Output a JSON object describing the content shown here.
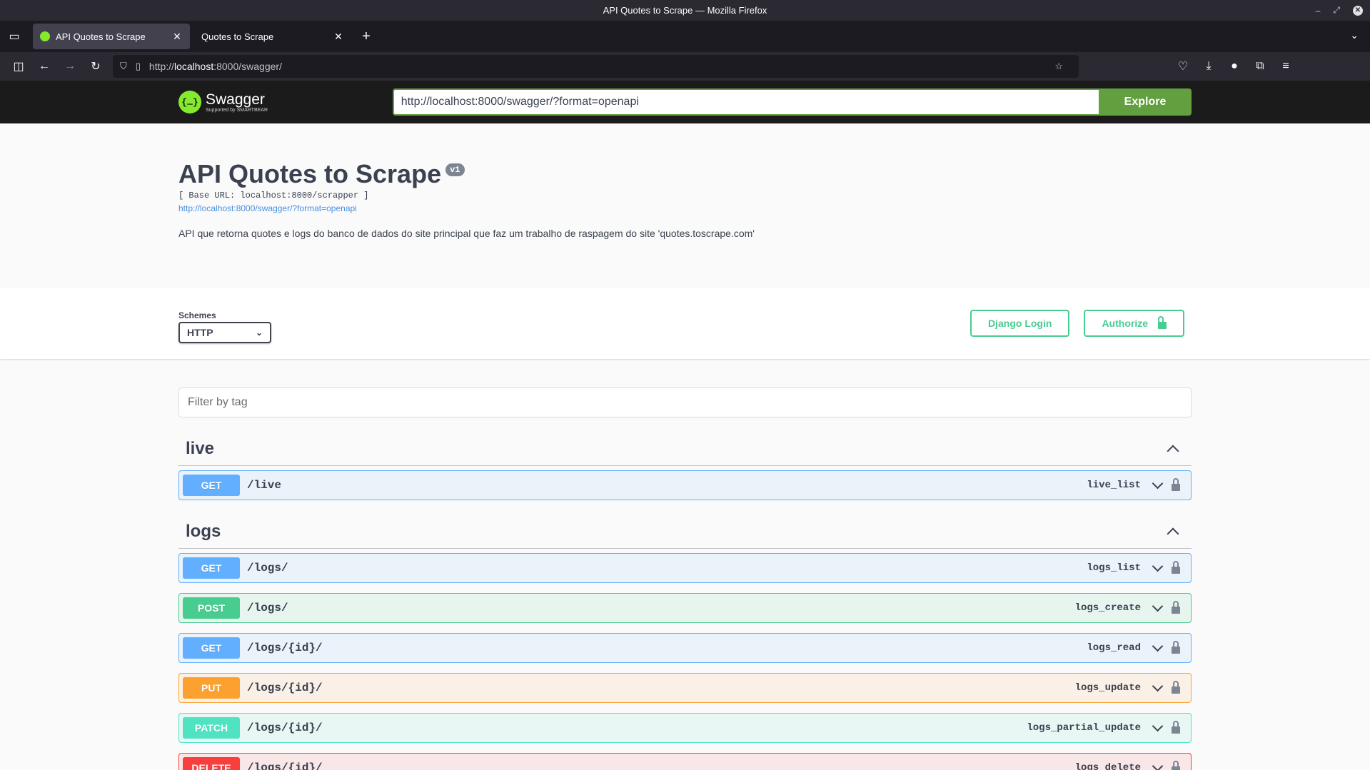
{
  "window": {
    "title": "API Quotes to Scrape — Mozilla Firefox"
  },
  "tabs": [
    {
      "label": "API Quotes to Scrape",
      "active": true
    },
    {
      "label": "Quotes to Scrape",
      "active": false
    }
  ],
  "urlbar": {
    "url_prefix": "http://",
    "url_host": "localhost",
    "url_rest": ":8000/swagger/"
  },
  "topbar": {
    "logo_text": "Swagger",
    "logo_sub": "Supported by SMARTBEAR",
    "spec_url": "http://localhost:8000/swagger/?format=openapi",
    "explore_label": "Explore"
  },
  "info": {
    "title": "API Quotes to Scrape",
    "version": "v1",
    "base_url": "[ Base URL: localhost:8000/scrapper ]",
    "spec_link": "http://localhost:8000/swagger/?format=openapi",
    "description": "API que retorna quotes e logs do banco de dados do site principal que faz um trabalho de raspagem do site 'quotes.toscrape.com'"
  },
  "schemes": {
    "label": "Schemes",
    "selected": "HTTP"
  },
  "auth": {
    "django_login": "Django Login",
    "authorize": "Authorize"
  },
  "filter": {
    "placeholder": "Filter by tag"
  },
  "tags": [
    {
      "name": "live",
      "operations": [
        {
          "method": "GET",
          "path": "/live",
          "operation_id": "live_list"
        }
      ]
    },
    {
      "name": "logs",
      "operations": [
        {
          "method": "GET",
          "path": "/logs/",
          "operation_id": "logs_list"
        },
        {
          "method": "POST",
          "path": "/logs/",
          "operation_id": "logs_create"
        },
        {
          "method": "GET",
          "path": "/logs/{id}/",
          "operation_id": "logs_read"
        },
        {
          "method": "PUT",
          "path": "/logs/{id}/",
          "operation_id": "logs_update"
        },
        {
          "method": "PATCH",
          "path": "/logs/{id}/",
          "operation_id": "logs_partial_update"
        },
        {
          "method": "DELETE",
          "path": "/logs/{id}/",
          "operation_id": "logs_delete"
        }
      ]
    }
  ],
  "colors": {
    "get": "#61affe",
    "post": "#49cc90",
    "put": "#fca130",
    "patch": "#50e3c2",
    "delete": "#f93e3e",
    "explore": "#62a03f"
  }
}
